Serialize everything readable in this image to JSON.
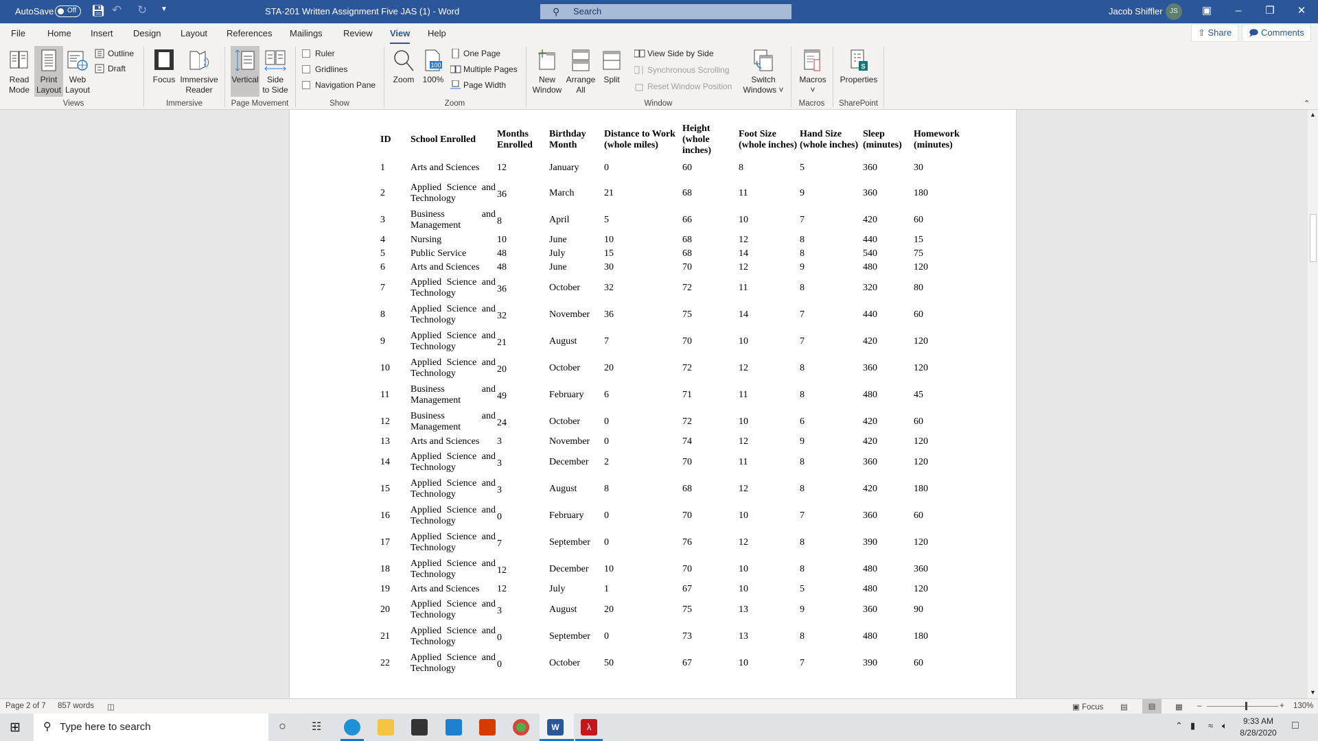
{
  "titlebar": {
    "autosave_label": "AutoSave",
    "autosave_state": "Off",
    "doc_title": "STA-201 Written Assignment Five  JAS (1)  -  Word",
    "search_placeholder": "Search",
    "user_name": "Jacob  Shiffler",
    "user_initials": "JS",
    "accent": "#2b579a"
  },
  "tabs": [
    {
      "label": "File"
    },
    {
      "label": "Home"
    },
    {
      "label": "Insert"
    },
    {
      "label": "Design"
    },
    {
      "label": "Layout"
    },
    {
      "label": "References"
    },
    {
      "label": "Mailings"
    },
    {
      "label": "Review"
    },
    {
      "label": "View",
      "active": true
    },
    {
      "label": "Help"
    }
  ],
  "share_label": "Share",
  "comments_label": "Comments",
  "ribbon": {
    "views": {
      "label": "Views",
      "read_mode": [
        "Read",
        "Mode"
      ],
      "print_layout": [
        "Print",
        "Layout"
      ],
      "web_layout": [
        "Web",
        "Layout"
      ],
      "outline": "Outline",
      "draft": "Draft"
    },
    "immersive": {
      "label": "Immersive",
      "focus": "Focus",
      "reader": [
        "Immersive",
        "Reader"
      ]
    },
    "page_movement": {
      "label": "Page Movement",
      "vertical": "Vertical",
      "side": [
        "Side",
        "to Side"
      ]
    },
    "show": {
      "label": "Show",
      "ruler": "Ruler",
      "gridlines": "Gridlines",
      "nav_pane": "Navigation Pane"
    },
    "zoom": {
      "label": "Zoom",
      "zoom": "Zoom",
      "hundred": "100%",
      "one_page": "One Page",
      "multiple_pages": "Multiple Pages",
      "page_width": "Page Width"
    },
    "window": {
      "label": "Window",
      "new_window": [
        "New",
        "Window"
      ],
      "arrange_all": [
        "Arrange",
        "All"
      ],
      "split": "Split",
      "side_by_side": "View Side by Side",
      "sync_scroll": "Synchronous Scrolling",
      "reset_pos": "Reset Window Position",
      "switch": [
        "Switch",
        "Windows"
      ]
    },
    "macros": {
      "label": "Macros",
      "macros": "Macros"
    },
    "sharepoint": {
      "label": "SharePoint",
      "properties": "Properties"
    }
  },
  "table": {
    "headers": [
      [
        "ID"
      ],
      [
        "School Enrolled"
      ],
      [
        "Months",
        "Enrolled"
      ],
      [
        "Birthday",
        "Month"
      ],
      [
        "Distance  to  Work",
        "(whole miles)"
      ],
      [
        "Height",
        "(whole",
        "inches)"
      ],
      [
        "Foot          Size",
        "(whole inches)"
      ],
      [
        "Hand          Size",
        "(whole inches)"
      ],
      [
        "Sleep",
        "(minutes)"
      ],
      [
        "Homework",
        "(minutes)"
      ]
    ],
    "rows": [
      [
        "1",
        "Arts and Sciences",
        "12",
        "January",
        "0",
        "60",
        "8",
        "5",
        "360",
        "30"
      ],
      [
        "2",
        "Applied Science and Technology",
        "36",
        "March",
        "21",
        "68",
        "11",
        "9",
        "360",
        "180"
      ],
      [
        "3",
        "Business and Management",
        "8",
        "April",
        "5",
        "66",
        "10",
        "7",
        "420",
        "60"
      ],
      [
        "4",
        "Nursing",
        "10",
        "June",
        "10",
        "68",
        "12",
        "8",
        "440",
        "15"
      ],
      [
        "5",
        "Public Service",
        "48",
        "July",
        "15",
        "68",
        "14",
        "8",
        "540",
        "75"
      ],
      [
        "6",
        "Arts and Sciences",
        "48",
        "June",
        "30",
        "70",
        "12",
        "9",
        "480",
        "120"
      ],
      [
        "7",
        "Applied Science and Technology",
        "36",
        "October",
        "32",
        "72",
        "11",
        "8",
        "320",
        "80"
      ],
      [
        "8",
        "Applied Science and Technology",
        "32",
        "November",
        "36",
        "75",
        "14",
        "7",
        "440",
        "60"
      ],
      [
        "9",
        "Applied Science and Technology",
        "21",
        "August",
        "7",
        "70",
        "10",
        "7",
        "420",
        "120"
      ],
      [
        "10",
        "Applied Science and Technology",
        "20",
        "October",
        "20",
        "72",
        "12",
        "8",
        "360",
        "120"
      ],
      [
        "11",
        "Business and Management",
        "49",
        "February",
        "6",
        "71",
        "11",
        "8",
        "480",
        "45"
      ],
      [
        "12",
        "Business and Management",
        "24",
        "October",
        "0",
        "72",
        "10",
        "6",
        "420",
        "60"
      ],
      [
        "13",
        "Arts and Sciences",
        "3",
        "November",
        "0",
        "74",
        "12",
        "9",
        "420",
        "120"
      ],
      [
        "14",
        "Applied Science and Technology",
        "3",
        "December",
        "2",
        "70",
        "11",
        "8",
        "360",
        "120"
      ],
      [
        "15",
        "Applied Science and Technology",
        "3",
        "August",
        "8",
        "68",
        "12",
        "8",
        "420",
        "180"
      ],
      [
        "16",
        "Applied Science and Technology",
        "0",
        "February",
        "0",
        "70",
        "10",
        "7",
        "360",
        "60"
      ],
      [
        "17",
        "Applied Science and Technology",
        "7",
        "September",
        "0",
        "76",
        "12",
        "8",
        "390",
        "120"
      ],
      [
        "18",
        "Applied Science and Technology",
        "12",
        "December",
        "10",
        "70",
        "10",
        "8",
        "480",
        "360"
      ],
      [
        "19",
        "Arts and Sciences",
        "12",
        "July",
        "1",
        "67",
        "10",
        "5",
        "480",
        "120"
      ],
      [
        "20",
        "Applied Science and Technology",
        "3",
        "August",
        "20",
        "75",
        "13",
        "9",
        "360",
        "90"
      ],
      [
        "21",
        "Applied Science and Technology",
        "0",
        "September",
        "0",
        "73",
        "13",
        "8",
        "480",
        "180"
      ],
      [
        "22",
        "Applied Science and Technology",
        "0",
        "October",
        "50",
        "67",
        "10",
        "7",
        "390",
        "60"
      ]
    ]
  },
  "status": {
    "page": "Page 2 of 7",
    "words": "857 words",
    "focus": "Focus",
    "zoom": "130%",
    "zoom_percent": 130
  },
  "taskbar": {
    "search_placeholder": "Type here to search",
    "time": "9:33 AM",
    "date": "8/28/2020"
  }
}
